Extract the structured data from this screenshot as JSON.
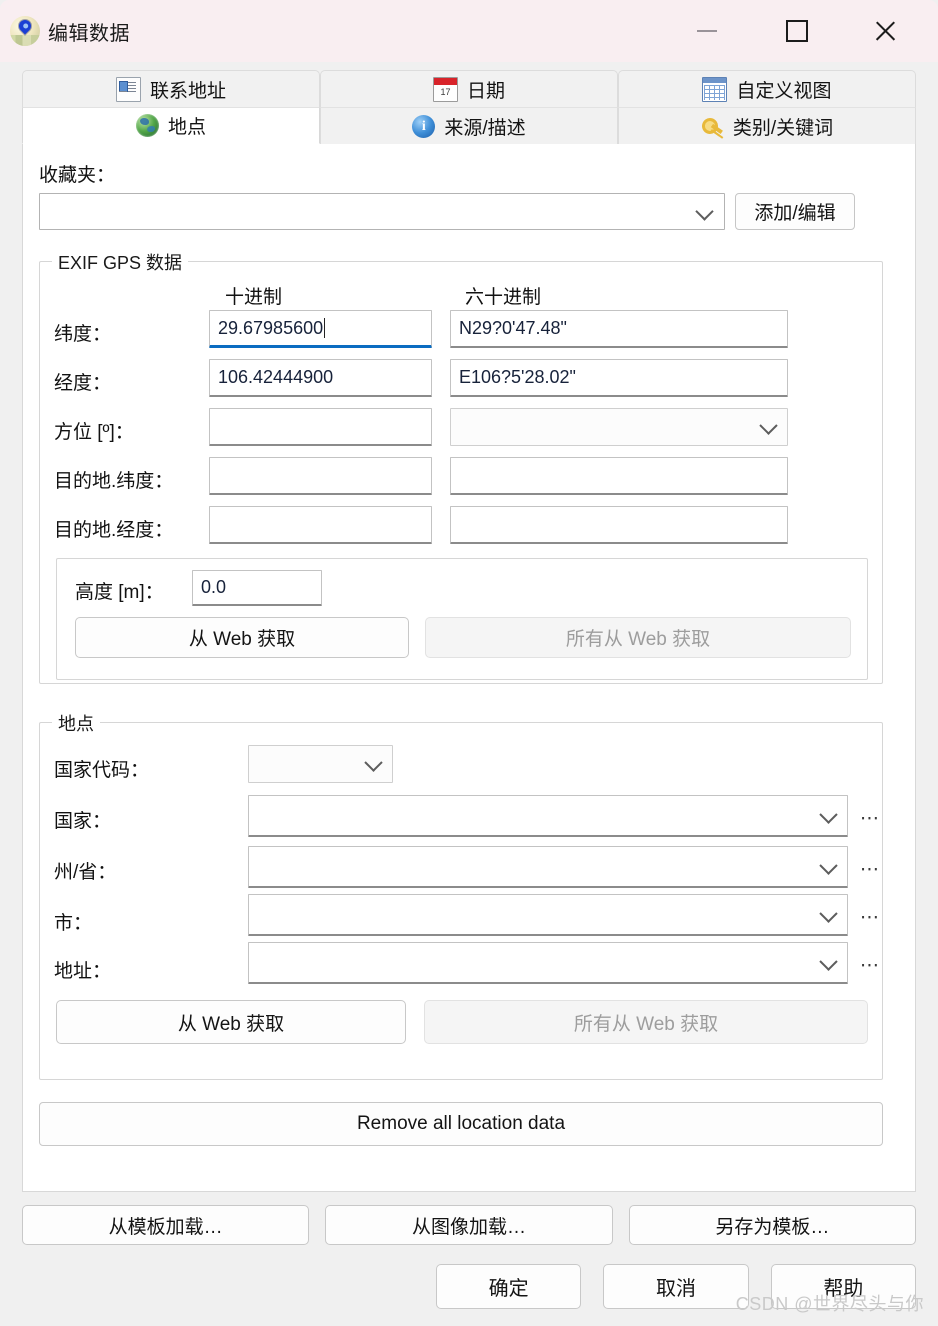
{
  "window": {
    "title": "编辑数据",
    "icon": "location-pin-icon",
    "minimize_label": "—",
    "maximize_label": "□",
    "close_label": "✕"
  },
  "tabs": {
    "row1": [
      {
        "label": "联系地址",
        "icon": "contact-card-icon",
        "selected": false
      },
      {
        "label": "日期",
        "icon": "calendar-icon",
        "selected": false
      },
      {
        "label": "自定义视图",
        "icon": "table-grid-icon",
        "selected": false
      }
    ],
    "row2": [
      {
        "label": "地点",
        "icon": "globe-icon",
        "selected": true
      },
      {
        "label": "来源/描述",
        "icon": "info-circle-icon",
        "selected": false
      },
      {
        "label": "类别/关键词",
        "icon": "key-icon",
        "selected": false
      }
    ]
  },
  "favorites": {
    "label": "收藏夹：",
    "value": "",
    "placeholder": "",
    "edit_button": "添加/编辑"
  },
  "gps": {
    "group_title": "EXIF GPS 数据",
    "col_decimal": "十进制",
    "col_sexagesimal": "六十进制",
    "rows": [
      {
        "label": "纬度：",
        "decimal": "29.67985600",
        "sexagesimal": "N29?0'47.48\"",
        "focused": true,
        "combo": false
      },
      {
        "label": "经度：",
        "decimal": "106.42444900",
        "sexagesimal": "E106?5'28.02\"",
        "focused": false,
        "combo": false
      },
      {
        "label": "方位 [º]：",
        "decimal": "",
        "sexagesimal": "",
        "focused": false,
        "combo": true
      },
      {
        "label": "目的地.纬度：",
        "decimal": "",
        "sexagesimal": "",
        "focused": false,
        "combo": false
      },
      {
        "label": "目的地.经度：",
        "decimal": "",
        "sexagesimal": "",
        "focused": false,
        "combo": false
      }
    ],
    "altitude": {
      "label": "高度 [m]：",
      "value": "0.0",
      "from_web": "从 Web 获取",
      "all_from_web": "所有从 Web 获取"
    }
  },
  "place": {
    "group_title": "地点",
    "country_code": {
      "label": "国家代码：",
      "value": ""
    },
    "rows": [
      {
        "label": "国家：",
        "value": "",
        "more": "⋯"
      },
      {
        "label": "州/省：",
        "value": "",
        "more": "⋯"
      },
      {
        "label": "市：",
        "value": "",
        "more": "⋯"
      },
      {
        "label": "地址：",
        "value": "",
        "more": "⋯"
      }
    ],
    "from_web": "从 Web 获取",
    "all_from_web": "所有从 Web 获取"
  },
  "remove_all_button": "Remove all location data",
  "template_buttons": [
    "从模板加载…",
    "从图像加载…",
    "另存为模板…"
  ],
  "action_buttons": {
    "ok": "确定",
    "cancel": "取消",
    "help": "帮助"
  },
  "watermark": "CSDN @世界尽头与你",
  "colors": {
    "titlebar": "#f9eef1",
    "window_bg": "#f0f0f0",
    "panel_bg": "#ffffff",
    "focus_underline": "#0a6cc1",
    "field_underline": "#8b8b8b"
  }
}
